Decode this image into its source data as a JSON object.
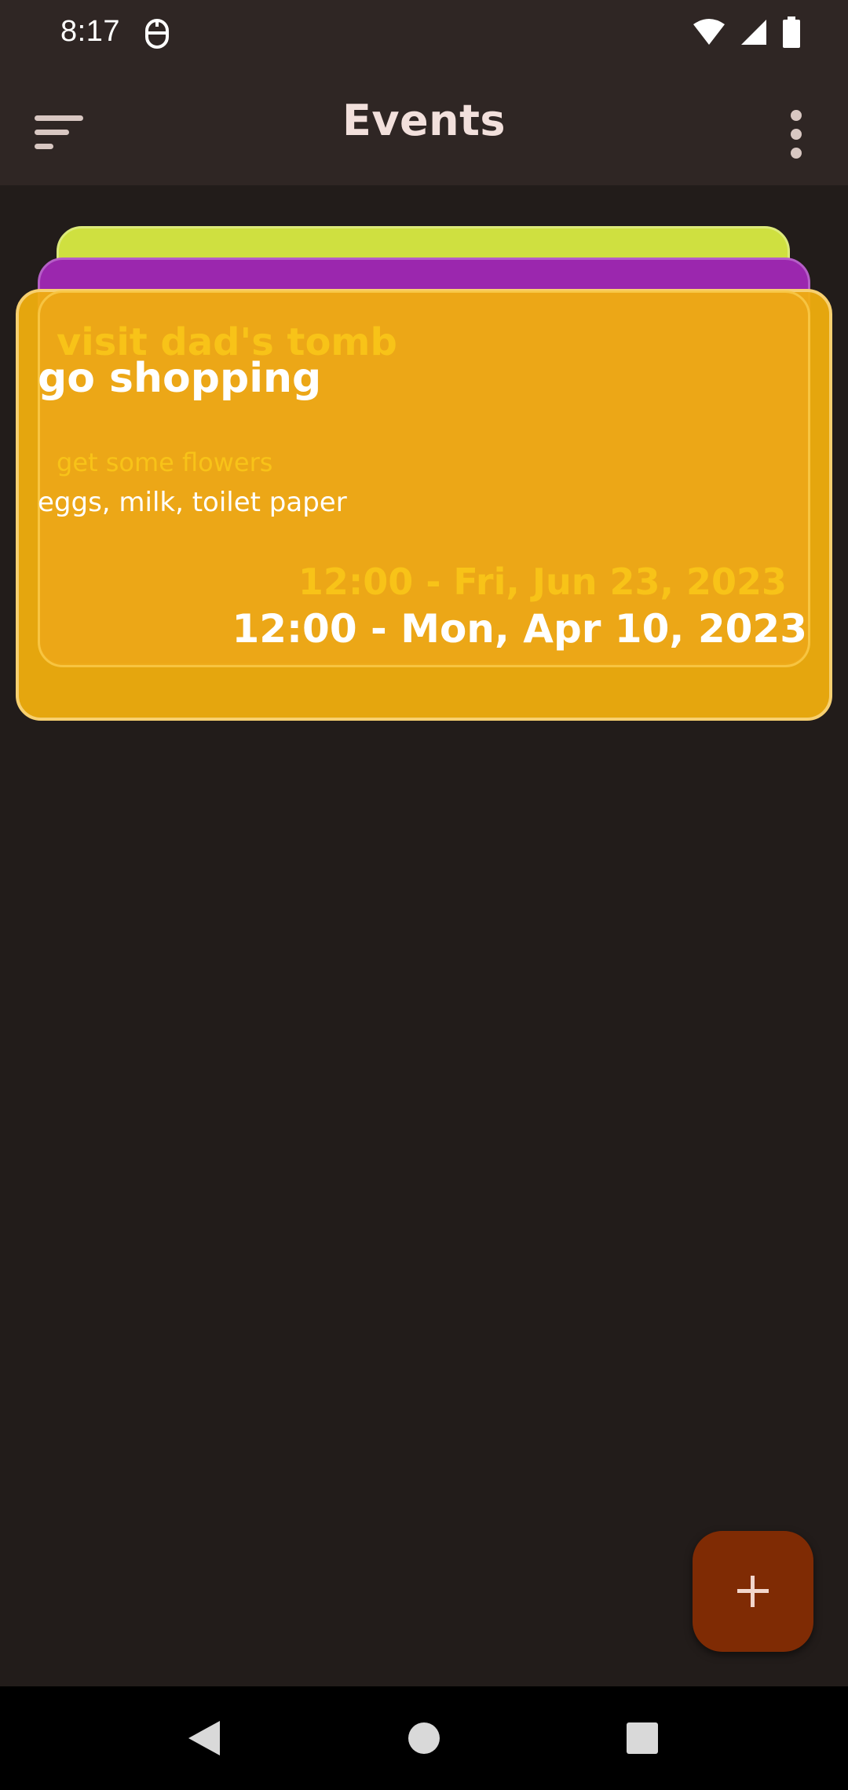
{
  "status_bar": {
    "time": "8:17",
    "icons": [
      "app-notification-icon",
      "wifi-icon",
      "signal-icon",
      "battery-icon"
    ]
  },
  "app_bar": {
    "title": "Events",
    "menu_icon": "sort-menu-icon",
    "more_icon": "more-vert-icon"
  },
  "events": [
    {
      "title": "go shopping",
      "description": "eggs, milk, toilet paper",
      "datetime": "12:00 - Mon, Apr 10, 2023",
      "color": "#f1af0e"
    },
    {
      "title": "visit dad's tomb",
      "description": "get some flowers",
      "datetime": "12:00 - Fri, Jun 23, 2023",
      "color": "#9b27ae"
    },
    {
      "title": "",
      "description": "",
      "datetime": "",
      "color": "#cfe040"
    }
  ],
  "fab": {
    "icon": "plus-icon",
    "color": "#7f2b04"
  },
  "nav_bar": {
    "icons": [
      "back-icon",
      "home-icon",
      "recents-icon"
    ]
  },
  "colors": {
    "background": "#221c1a",
    "app_bar": "#2f2624",
    "title_text": "#f2e0dc"
  }
}
